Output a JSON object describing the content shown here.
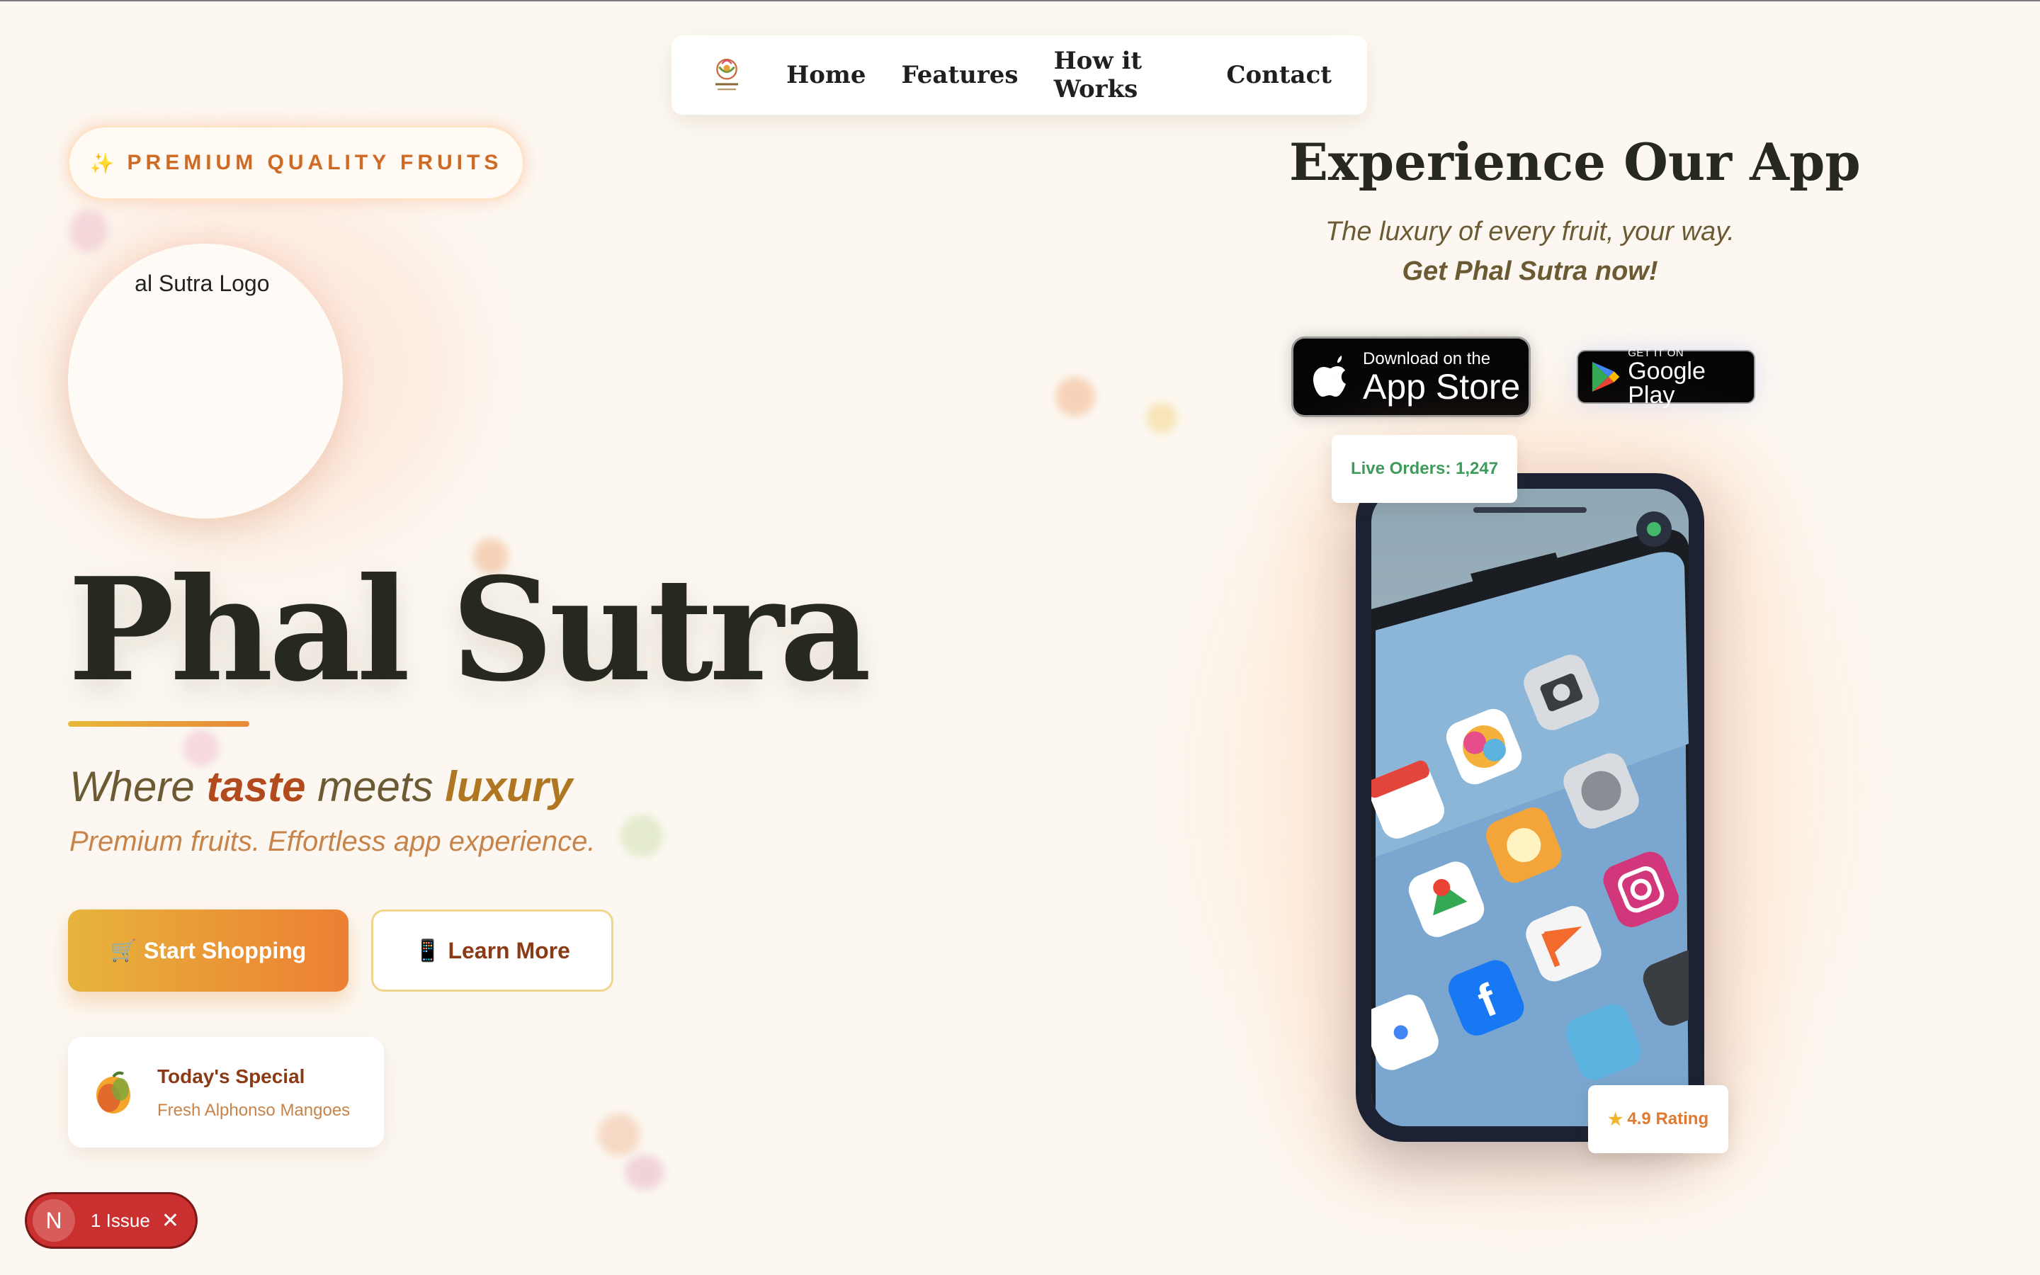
{
  "nav": {
    "links": [
      "Home",
      "Features",
      "How it Works",
      "Contact"
    ]
  },
  "hero": {
    "badge": "PREMIUM QUALITY FRUITS",
    "badge_icon": "sparkle-icon",
    "logo_alt": "Phal Sutra Logo",
    "title": "Phal Sutra",
    "tagline": {
      "pre": "Where ",
      "word1": "taste",
      "mid": " meets ",
      "word2": "luxury"
    },
    "subtitle": "Premium fruits. Effortless app experience.",
    "primary_button": "Start Shopping",
    "primary_icon": "🛒",
    "secondary_button": "Learn More",
    "secondary_icon": "📱"
  },
  "special": {
    "title": "Today's Special",
    "subtitle": "Fresh Alphonso Mangoes"
  },
  "app": {
    "heading": "Experience Our App",
    "tagline1": "The luxury of every fruit, your way.",
    "tagline2": "Get Phal Sutra now!",
    "appstore_small": "Download on the",
    "appstore_big": "App Store",
    "gplay_small": "GET IT ON",
    "gplay_big": "Google Play",
    "live_orders": "Live Orders: 1,247",
    "rating": "4.9 Rating"
  },
  "dev_overlay": {
    "letter": "N",
    "issues": "1 Issue"
  },
  "colors": {
    "background": "#fcf8f1",
    "accent_orange": "#ec7f33",
    "accent_gold": "#e7b43c",
    "title": "#27291f",
    "issue_red": "#c9302f",
    "live_green": "#3f9b5a"
  }
}
